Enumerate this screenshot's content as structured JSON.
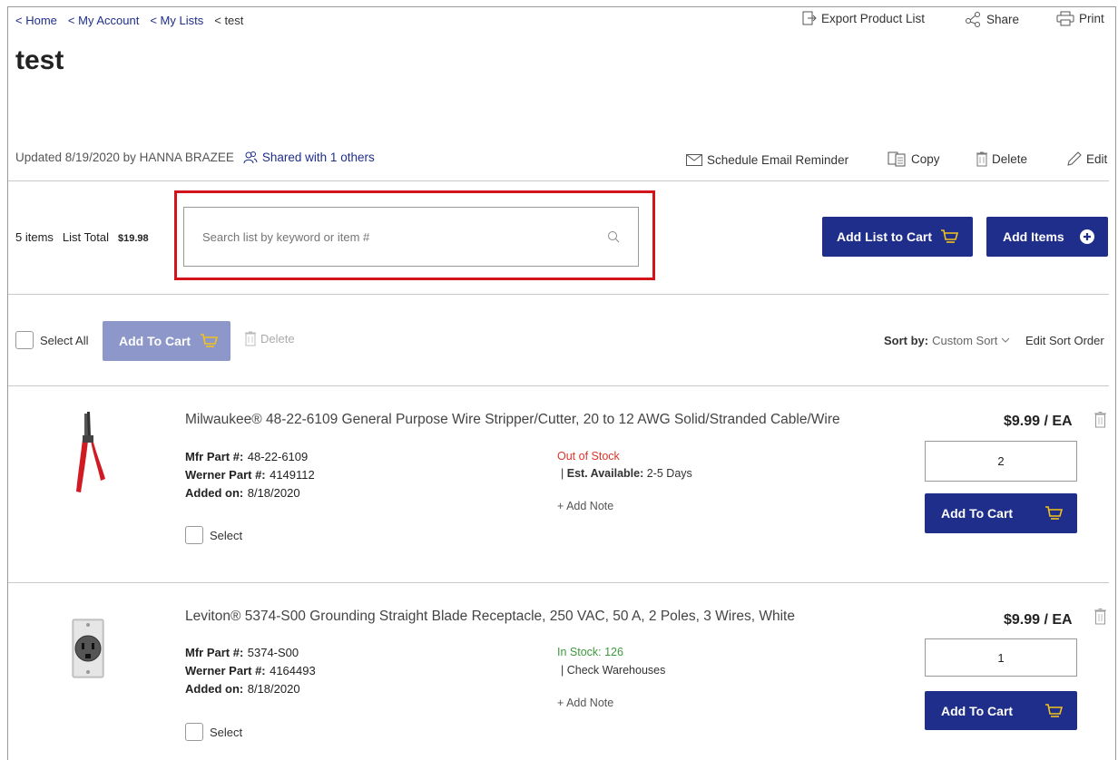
{
  "breadcrumb": [
    {
      "label": "Home"
    },
    {
      "label": "My Account"
    },
    {
      "label": "My Lists"
    },
    {
      "label": "test"
    }
  ],
  "header_actions": {
    "export": "Export Product List",
    "share": "Share",
    "print": "Print"
  },
  "page_title": "test",
  "meta": {
    "updated": "Updated 8/19/2020 by HANNA BRAZEE",
    "shared": "Shared with 1 others"
  },
  "list_actions": {
    "schedule": "Schedule Email Reminder",
    "copy": "Copy",
    "delete": "Delete",
    "edit": "Edit"
  },
  "summary": {
    "items": "5 items",
    "list_total_label": "List Total",
    "list_total_value": "$19.98"
  },
  "search": {
    "placeholder": "Search list by keyword or item #",
    "value": ""
  },
  "buttons": {
    "add_list_to_cart": "Add List to Cart",
    "add_items": "Add Items"
  },
  "toolbar": {
    "select_all": "Select All",
    "add_to_cart": "Add To Cart",
    "delete": "Delete",
    "sort_by_label": "Sort by:",
    "sort_by_value": "Custom Sort",
    "edit_sort_order": "Edit Sort Order"
  },
  "products": [
    {
      "title": "Milwaukee® 48-22-6109 General Purpose Wire Stripper/Cutter, 20 to 12 AWG Solid/Stranded Cable/Wire",
      "mfr_label": "Mfr Part #:",
      "mfr_value": "48-22-6109",
      "werner_label": "Werner Part #:",
      "werner_value": "4149112",
      "added_label": "Added on:",
      "added_value": "8/18/2020",
      "stock": "Out of Stock",
      "stock_color": "#d9352b",
      "avail_prefix": "| ",
      "avail_label": "Est. Available:",
      "avail_value": "2-5 Days",
      "add_note": "+ Add Note",
      "select": "Select",
      "price": "$9.99 / EA",
      "qty": "2",
      "add_to_cart": "Add To Cart"
    },
    {
      "title": "Leviton® 5374-S00 Grounding Straight Blade Receptacle, 250 VAC, 50 A, 2 Poles, 3 Wires, White",
      "mfr_label": "Mfr Part #:",
      "mfr_value": "5374-S00",
      "werner_label": "Werner Part #:",
      "werner_value": "4164493",
      "added_label": "Added on:",
      "added_value": "8/18/2020",
      "stock": "In Stock: 126",
      "stock_color": "#3c9a3c",
      "avail_prefix": "| ",
      "avail_label": "",
      "avail_value": "Check Warehouses",
      "add_note": "+ Add Note",
      "select": "Select",
      "price": "$9.99 / EA",
      "qty": "1",
      "add_to_cart": "Add To Cart"
    }
  ],
  "colors": {
    "brand_blue": "#1f2e8a",
    "disabled_blue": "#8e97c9",
    "highlight_red": "#d4141c",
    "out_of_stock": "#d9352b",
    "in_stock": "#3c9a3c"
  }
}
